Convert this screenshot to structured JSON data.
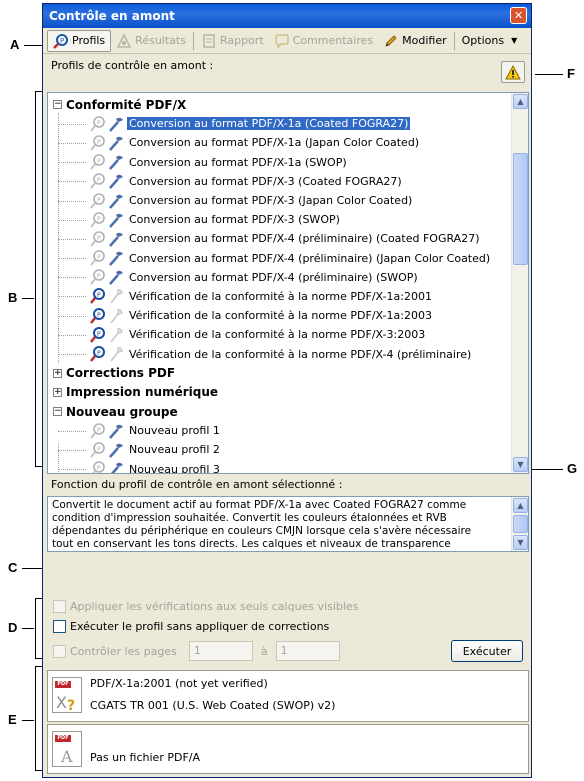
{
  "window": {
    "title": "Contrôle en amont"
  },
  "toolbar": {
    "profils": "Profils",
    "resultats": "Résultats",
    "rapport": "Rapport",
    "commentaires": "Commentaires",
    "modifier": "Modifier",
    "options": "Options"
  },
  "subhead": {
    "label": "Profils de contrôle en amont :"
  },
  "tree": {
    "group1": "Conformité PDF/X",
    "items": [
      "Conversion au format PDF/X-1a (Coated FOGRA27)",
      "Conversion au format PDF/X-1a (Japan Color Coated)",
      "Conversion au format PDF/X-1a (SWOP)",
      "Conversion au format PDF/X-3 (Coated FOGRA27)",
      "Conversion au format PDF/X-3 (Japan Color Coated)",
      "Conversion au format PDF/X-3 (SWOP)",
      "Conversion au format PDF/X-4 (préliminaire) (Coated FOGRA27)",
      "Conversion au format PDF/X-4 (préliminaire) (Japan Color Coated)",
      "Conversion au format PDF/X-4 (préliminaire) (SWOP)",
      "Vérification de la conformité à la norme PDF/X-1a:2001",
      "Vérification de la conformité à la norme PDF/X-1a:2003",
      "Vérification de la conformité à la norme PDF/X-3:2003",
      "Vérification de la conformité à la norme PDF/X-4 (préliminaire)"
    ],
    "group2": "Corrections PDF",
    "group3": "Impression numérique",
    "group4": "Nouveau groupe",
    "newItems": [
      "Nouveau profil 1",
      "Nouveau profil 2",
      "Nouveau profil 3"
    ]
  },
  "function": {
    "label": "Fonction du profil de contrôle en amont sélectionné :",
    "lines": [
      "Convertit le document actif au format PDF/X-1a avec Coated FOGRA27 comme",
      "condition d'impression souhaitée. Convertit les couleurs étalonnées et RVB",
      "dépendantes du périphérique en couleurs CMJN lorsque cela s'avère nécessaire",
      "tout en conservant les tons directs. Les calques et niveaux de transparence"
    ]
  },
  "options": {
    "visible_layers": "Appliquer les vérifications aux seuls calques visibles",
    "no_fix": "Exécuter le profil sans appliquer de corrections",
    "check_pages": "Contrôler les pages",
    "from": "1",
    "to_label": "à",
    "to": "1",
    "run": "Exécuter"
  },
  "status": {
    "pdfx_version": "PDF/X-1a:2001 (not yet verified)",
    "pdfx_profile": "CGATS TR 001 (U.S. Web Coated (SWOP) v2)",
    "pdfa": "Pas un fichier PDF/A"
  },
  "callouts": {
    "A": "A",
    "B": "B",
    "C": "C",
    "D": "D",
    "E": "E",
    "F": "F",
    "G": "G"
  },
  "colors": {
    "selection": "#316ac5",
    "titlebar": "#0a5bd8",
    "dialog": "#ece9d8"
  }
}
